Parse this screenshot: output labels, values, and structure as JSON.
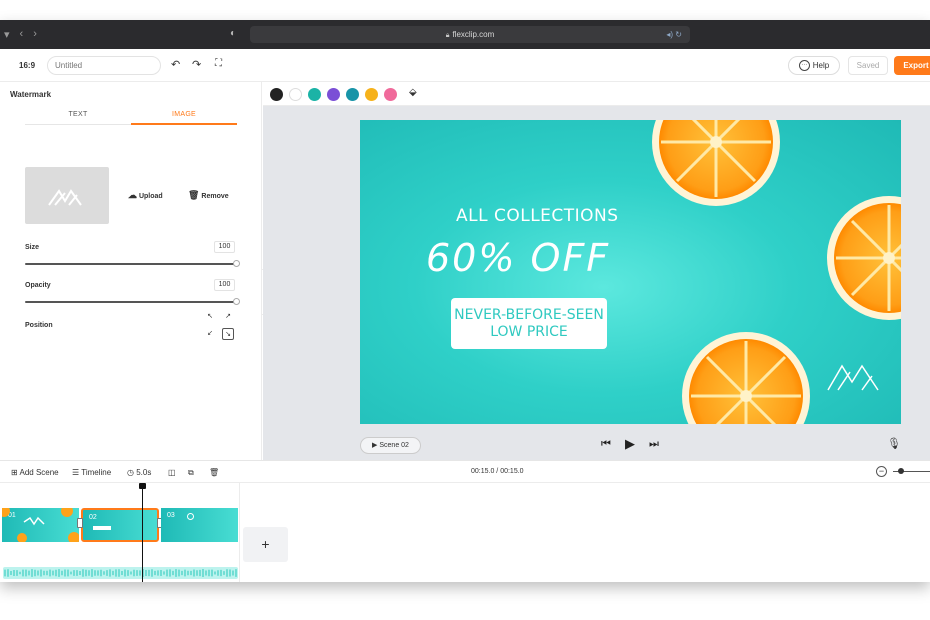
{
  "browser": {
    "url": "flexclip.com"
  },
  "toolbar": {
    "ratio": "16:9",
    "title_placeholder": "Untitled",
    "help_label": "Help",
    "saved_label": "Saved",
    "export_label": "Export"
  },
  "left_panel": {
    "title": "Watermark",
    "tabs": [
      {
        "label": "TEXT"
      },
      {
        "label": "IMAGE",
        "active": true
      }
    ],
    "upload_label": "Upload",
    "remove_label": "Remove",
    "size": {
      "label": "Size",
      "value": "100",
      "fraction": 1.0
    },
    "opacity": {
      "label": "Opacity",
      "value": "100",
      "fraction": 1.0
    },
    "position": {
      "label": "Position",
      "selected": "bottom-right"
    }
  },
  "color_bar": {
    "colors": [
      "#222222",
      "#ffffff",
      "#1bb3a6",
      "#7b4fd6",
      "#1894a8",
      "#f6b21b",
      "#f06a9b"
    ]
  },
  "canvas": {
    "headline": "ALL COLLECTIONS",
    "offer": "60% OFF",
    "badge_line1": "NEVER-BEFORE-SEEN",
    "badge_line2": "LOW PRICE"
  },
  "player": {
    "scene_label": "Scene 02"
  },
  "timeline": {
    "add_scene_label": "Add Scene",
    "timeline_label": "Timeline",
    "duration": "5.0s",
    "time_display": "00:15.0 / 00:15.0",
    "clips": [
      {
        "num": "01"
      },
      {
        "num": "02",
        "selected": true
      },
      {
        "num": "03"
      }
    ],
    "add_label": "+"
  },
  "accent_color": "#ff7a1a"
}
